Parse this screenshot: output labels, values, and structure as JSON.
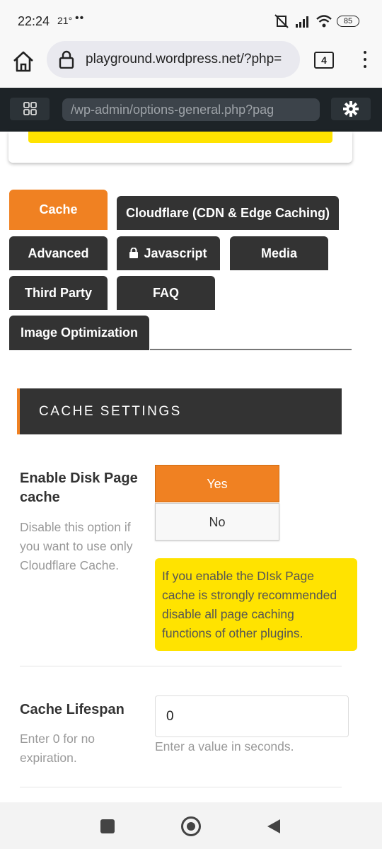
{
  "status_bar": {
    "time": "22:24",
    "temp": "21°",
    "dots": "••",
    "battery": "85"
  },
  "browser": {
    "url": "playground.wordpress.net/?php=",
    "tab_count": "4"
  },
  "wp_bar": {
    "address": "/wp-admin/options-general.php?pag"
  },
  "tabs": [
    {
      "label": "Cache",
      "active": true
    },
    {
      "label": "Cloudflare (CDN & Edge Caching)"
    },
    {
      "label": "Advanced"
    },
    {
      "label": "Javascript",
      "icon": "lock-icon"
    },
    {
      "label": "Media"
    },
    {
      "label": "Third Party"
    },
    {
      "label": "FAQ"
    },
    {
      "label": "Image Optimization"
    }
  ],
  "section": {
    "title": "CACHE SETTINGS"
  },
  "disk_cache": {
    "title_line1": "Enable Disk Page",
    "title_line2": "cache",
    "desc_line1": "Disable this option if",
    "desc_line2": "you want to use only",
    "desc_line3": "Cloudflare Cache.",
    "yes_label": "Yes",
    "no_label": "No",
    "selected": "Yes",
    "note_line1": "If you enable the DIsk Page",
    "note_line2": "cache is strongly recommended",
    "note_line3": "disable all page caching",
    "note_line4": "functions of other plugins."
  },
  "lifespan": {
    "title": "Cache Lifespan",
    "desc_line1": "Enter 0 for no",
    "desc_line2": "expiration.",
    "value": "0",
    "hint": "Enter a value in seconds."
  },
  "colors": {
    "accent": "#f08122",
    "tab_dark": "#333333",
    "note_yellow": "#ffe300",
    "wp_bar": "#1d2327"
  }
}
